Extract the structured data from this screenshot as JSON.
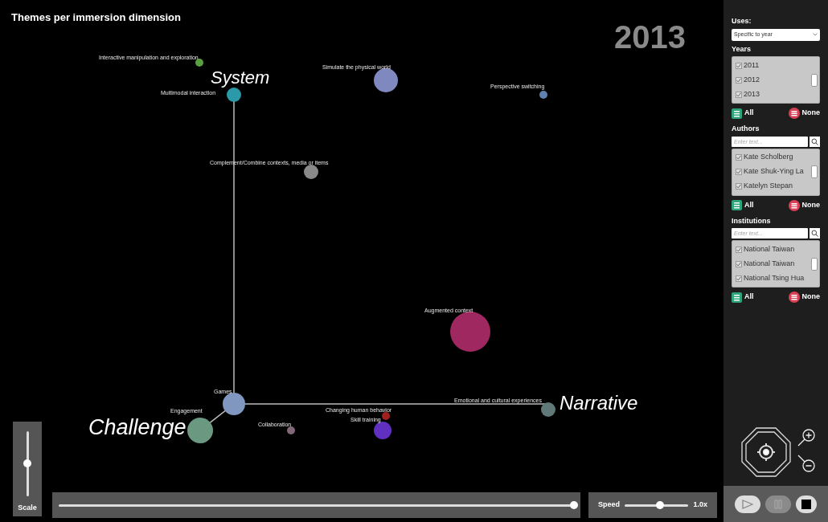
{
  "title": "Themes per immersion dimension",
  "year": "2013",
  "axes": [
    {
      "label": "System"
    },
    {
      "label": "Narrative"
    },
    {
      "label": "Challenge"
    }
  ],
  "themes": [
    {
      "label": "Interactive manipulation and exploration",
      "color": "#5aa040"
    },
    {
      "label": "Simulate the physical world",
      "color": "#8088c0"
    },
    {
      "label": "Perspective switching",
      "color": "#6080b0"
    },
    {
      "label": "Multimodal interaction",
      "color": "#2a9aa8"
    },
    {
      "label": "Complement/Combine contexts, media or items",
      "color": "#8a8a8a"
    },
    {
      "label": "Augmented context",
      "color": "#a02860"
    },
    {
      "label": "Games",
      "color": "#8098c0"
    },
    {
      "label": "Engagement",
      "color": "#6a9880"
    },
    {
      "label": "Collaboration",
      "color": "#806878"
    },
    {
      "label": "Changing human behavior",
      "color": "#a02020"
    },
    {
      "label": "Skill training",
      "color": "#6030c0"
    },
    {
      "label": "Emotional and cultural experiences",
      "color": "#607878"
    }
  ],
  "scale": {
    "label": "Scale",
    "level": 0.5
  },
  "timeline": {
    "level": 1
  },
  "speed": {
    "label": "Speed",
    "level": 0.55,
    "reading": "1.0x"
  },
  "sidebar": {
    "uses": {
      "label": "Uses:",
      "value": "Specific to year"
    },
    "filters": [
      {
        "title": "Years",
        "items": [
          {
            "label": "2011",
            "checked": true
          },
          {
            "label": "2012",
            "checked": true
          },
          {
            "label": "2013",
            "checked": true
          }
        ],
        "all": "All",
        "none": "None"
      },
      {
        "title": "Authors",
        "placeholder": "Enter text...",
        "items": [
          {
            "label": "Kate Scholberg",
            "checked": true
          },
          {
            "label": "Kate Shuk-Ying La",
            "checked": true
          },
          {
            "label": "Katelyn Stepan",
            "checked": true
          }
        ],
        "all": "All",
        "none": "None"
      },
      {
        "title": "Institutions",
        "placeholder": "Enter text...",
        "items": [
          {
            "label": "National Taiwan",
            "checked": true
          },
          {
            "label": "National Taiwan",
            "checked": true
          },
          {
            "label": "National Tsing Hua",
            "checked": true
          }
        ],
        "all": "All",
        "none": "None"
      }
    ]
  }
}
